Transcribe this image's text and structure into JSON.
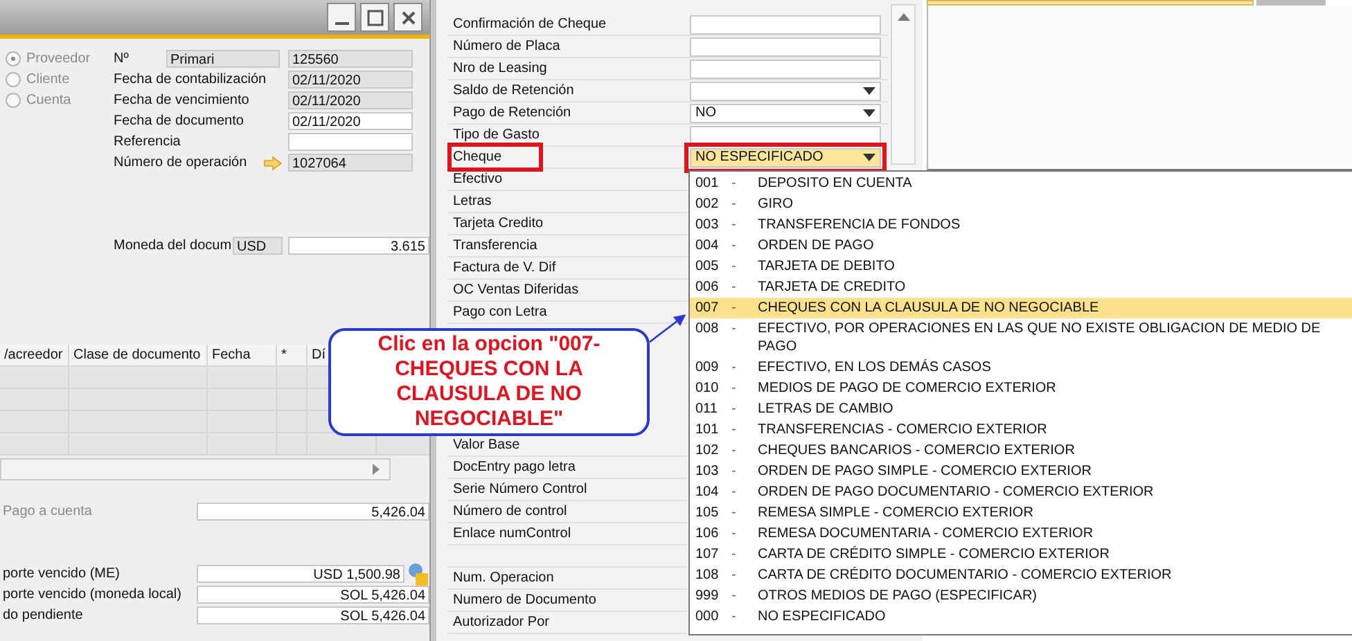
{
  "partner_type": [
    {
      "label": "Proveedor",
      "selected": true
    },
    {
      "label": "Cliente",
      "selected": false
    },
    {
      "label": "Cuenta",
      "selected": false
    }
  ],
  "header_fields": [
    {
      "kind": "series",
      "label": "Nº",
      "series": "Primari",
      "value": "125560",
      "editable": false
    },
    {
      "kind": "plain",
      "label": "Fecha de contabilización",
      "value": "02/11/2020",
      "editable": false
    },
    {
      "kind": "plain",
      "label": "Fecha de vencimiento",
      "value": "02/11/2020",
      "editable": false
    },
    {
      "kind": "plain",
      "label": "Fecha de documento",
      "value": "02/11/2020",
      "editable": true
    },
    {
      "kind": "plain",
      "label": "Referencia",
      "editable": true
    },
    {
      "kind": "link",
      "label": "Número de operación",
      "value": "1027064",
      "editable": false
    }
  ],
  "currency": {
    "label": "Moneda del docum",
    "code": "USD",
    "rate": "3.615"
  },
  "table": {
    "columns": [
      "/acreedor",
      "Clase de documento",
      "Fecha",
      "*",
      "Dí"
    ]
  },
  "totals_top": [
    {
      "label": "Pago a cuenta",
      "value": "5,426.04",
      "disabled": true,
      "icon": false
    }
  ],
  "totals": [
    {
      "label": "porte vencido (ME)",
      "value": "USD 1,500.98",
      "disabled": false,
      "icon": true
    },
    {
      "label": "porte vencido (moneda local)",
      "value": "SOL 5,426.04",
      "disabled": false,
      "icon": false
    },
    {
      "label": "do pendiente",
      "value": "SOL 5,426.04",
      "disabled": false,
      "icon": false
    }
  ],
  "fields_upper": [
    {
      "label": "Confirmación de Cheque",
      "kind": "text"
    },
    {
      "label": "Número de Placa",
      "kind": "text"
    },
    {
      "label": "Nro de Leasing",
      "kind": "text"
    },
    {
      "label": "Saldo de Retención",
      "kind": "combo"
    },
    {
      "label": "Pago de Retención",
      "kind": "combo",
      "value": "NO"
    },
    {
      "label": "Tipo de Gasto",
      "kind": "text"
    },
    {
      "label": "Cheque",
      "kind": "combo",
      "value": "NO ESPECIFICADO",
      "highlighted": true,
      "focused": true
    },
    {
      "label": "Efectivo",
      "kind": "none"
    },
    {
      "label": "Letras",
      "kind": "none"
    },
    {
      "label": "Tarjeta Credito",
      "kind": "none"
    },
    {
      "label": "Transferencia",
      "kind": "none"
    },
    {
      "label": "Factura de V. Dif",
      "kind": "none"
    },
    {
      "label": "OC Ventas Diferidas",
      "kind": "none"
    },
    {
      "label": "Pago con Letra",
      "kind": "none"
    }
  ],
  "fields_middle": [
    {
      "label": "Valor Base"
    },
    {
      "label": "DocEntry pago letra"
    },
    {
      "label": "Serie Número Control"
    },
    {
      "label": "Número de control"
    },
    {
      "label": "Enlace numControl"
    }
  ],
  "fields_lower": [
    {
      "label": "Num. Operacion"
    },
    {
      "label": "Numero de Documento"
    },
    {
      "label": "Autorizador Por"
    }
  ],
  "dropdown_options": [
    {
      "code": "001",
      "separator": "-",
      "label": "DEPOSITO EN CUENTA",
      "selected": false
    },
    {
      "code": "002",
      "separator": "-",
      "label": "GIRO",
      "selected": false
    },
    {
      "code": "003",
      "separator": "-",
      "label": "TRANSFERENCIA DE FONDOS",
      "selected": false
    },
    {
      "code": "004",
      "separator": "-",
      "label": "ORDEN DE PAGO",
      "selected": false
    },
    {
      "code": "005",
      "separator": "-",
      "label": "TARJETA DE DEBITO",
      "selected": false
    },
    {
      "code": "006",
      "separator": "-",
      "label": "TARJETA DE CREDITO",
      "selected": false
    },
    {
      "code": "007",
      "separator": "-",
      "label": "CHEQUES CON LA CLAUSULA DE NO NEGOCIABLE",
      "selected": true
    },
    {
      "code": "008",
      "separator": "-",
      "label": "EFECTIVO, POR OPERACIONES EN LAS QUE NO EXISTE OBLIGACION DE MEDIO DE PAGO",
      "selected": false
    },
    {
      "code": "009",
      "separator": "-",
      "label": "EFECTIVO, EN LOS DEMÁS CASOS",
      "selected": false
    },
    {
      "code": "010",
      "separator": "-",
      "label": "MEDIOS DE PAGO DE COMERCIO EXTERIOR",
      "selected": false
    },
    {
      "code": "011",
      "separator": "-",
      "label": "LETRAS DE CAMBIO",
      "selected": false
    },
    {
      "code": "101",
      "separator": "-",
      "label": "TRANSFERENCIAS - COMERCIO EXTERIOR",
      "selected": false
    },
    {
      "code": "102",
      "separator": "-",
      "label": "CHEQUES BANCARIOS - COMERCIO EXTERIOR",
      "selected": false
    },
    {
      "code": "103",
      "separator": "-",
      "label": "ORDEN DE PAGO SIMPLE - COMERCIO EXTERIOR",
      "selected": false
    },
    {
      "code": "104",
      "separator": "-",
      "label": "ORDEN DE PAGO DOCUMENTARIO - COMERCIO EXTERIOR",
      "selected": false
    },
    {
      "code": "105",
      "separator": "-",
      "label": "REMESA SIMPLE - COMERCIO EXTERIOR",
      "selected": false
    },
    {
      "code": "106",
      "separator": "-",
      "label": "REMESA DOCUMENTARIA - COMERCIO EXTERIOR",
      "selected": false
    },
    {
      "code": "107",
      "separator": "-",
      "label": "CARTA DE CRÉDITO SIMPLE - COMERCIO EXTERIOR",
      "selected": false
    },
    {
      "code": "108",
      "separator": "-",
      "label": "CARTA DE CRÉDITO DOCUMENTARIO - COMERCIO EXTERIOR",
      "selected": false
    },
    {
      "code": "999",
      "separator": "-",
      "label": "OTROS MEDIOS DE PAGO (ESPECIFICAR)",
      "selected": false
    },
    {
      "code": "000",
      "separator": "-",
      "label": "NO ESPECIFICADO",
      "selected": false
    }
  ],
  "callout": {
    "text": "Clic en la opcion \"007-CHEQUES CON LA CLAUSULA DE NO NEGOCIABLE\""
  }
}
